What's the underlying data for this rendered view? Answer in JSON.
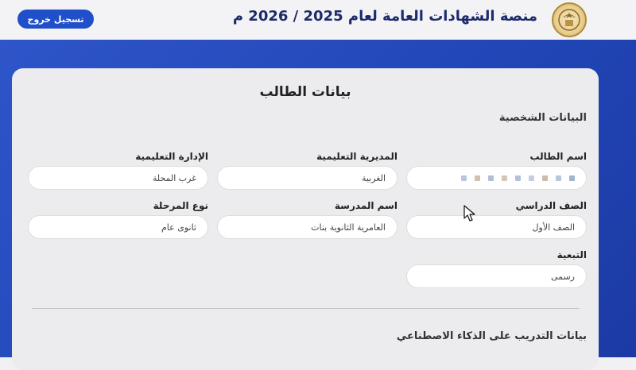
{
  "header": {
    "title": "منصة الشهادات العامة لعام 2025 / 2026 م",
    "logout_label": "تسجيل خروج",
    "logo_icon": "ministry-emblem-icon"
  },
  "card": {
    "title": "بيانات الطالب",
    "personal_section": "البيانات الشخصية",
    "training_section": "بيانات التدريب على الذكاء الاصطناعي"
  },
  "fields": {
    "student_name": {
      "label": "اسم الطالب",
      "value": ""
    },
    "directorate": {
      "label": "المديرية التعليمية",
      "value": "الغربية"
    },
    "administration": {
      "label": "الإدارة التعليمية",
      "value": "غرب المحلة"
    },
    "grade": {
      "label": "الصف الدراسي",
      "value": "الصف الأول"
    },
    "school": {
      "label": "اسم المدرسة",
      "value": "العامرية الثانوية بنات"
    },
    "stage_type": {
      "label": "نوع المرحلة",
      "value": "ثانوى عام"
    },
    "affiliation": {
      "label": "التبعية",
      "value": "رسمى"
    }
  },
  "colors": {
    "accent": "#1f4fc9",
    "background_blue": "#2247b8",
    "title_navy": "#1d2a6b"
  }
}
